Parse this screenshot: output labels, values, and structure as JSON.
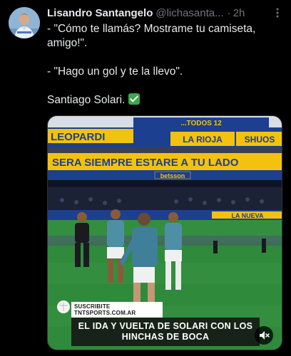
{
  "tweet": {
    "author_name": "Lisandro Santangelo",
    "handle": "@lichasanta...",
    "separator": "·",
    "time": "2h",
    "lines": [
      "- \"Cómo te llamás? Mostrame tu camiseta, amigo!\".",
      "- \"Hago un gol y te la llevo\".",
      "Santiago Solari."
    ],
    "check_icon": "check-mark-button-icon",
    "more_icon": "more-options-icon"
  },
  "media": {
    "banners": {
      "top_partial": "...TODOS 12",
      "row1_left": "LEOPARDI",
      "row1_mid": "LA RIOJA",
      "row1_right": "SHUOS",
      "row2": "SERA SIEMPRE ESTARE A TU LADO",
      "row2_right": "betsson",
      "field_banner": "LA NUEVA",
      "board_left": "..."
    },
    "caption_top": "SUSCRIBITE TNTSPORTS.COM.AR",
    "caption_main": "EL IDA Y VUELTA DE SOLARI CON LOS HINCHAS DE BOCA",
    "mute_icon": "speaker-muted-icon",
    "colors": {
      "boca_blue": "#1d3f8f",
      "boca_yellow": "#f2c20f",
      "pitch": "#2f8a3b"
    }
  }
}
